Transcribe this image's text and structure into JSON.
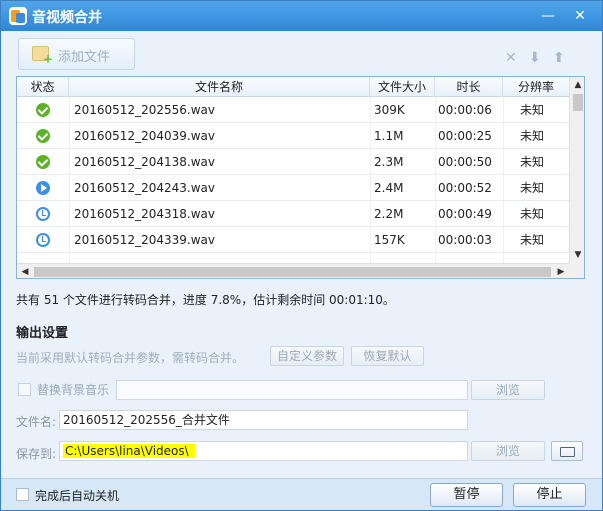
{
  "window": {
    "title": "音视频合并"
  },
  "titlebar": {
    "minimize_icon": "—",
    "close_icon": "✕"
  },
  "toolbar": {
    "add_files_label": "添加文件",
    "remove_icon": "✕",
    "move_down_icon": "⬇",
    "move_up_icon": "⬆"
  },
  "table": {
    "columns": [
      "状态",
      "文件名称",
      "文件大小",
      "时长",
      "分辨率"
    ],
    "rows": [
      {
        "status": "done",
        "name": "20160512_202556.wav",
        "size": "309K",
        "duration": "00:00:06",
        "resolution": "未知"
      },
      {
        "status": "done",
        "name": "20160512_204039.wav",
        "size": "1.1M",
        "duration": "00:00:25",
        "resolution": "未知"
      },
      {
        "status": "done",
        "name": "20160512_204138.wav",
        "size": "2.3M",
        "duration": "00:00:50",
        "resolution": "未知"
      },
      {
        "status": "processing",
        "name": "20160512_204243.wav",
        "size": "2.4M",
        "duration": "00:00:52",
        "resolution": "未知"
      },
      {
        "status": "waiting",
        "name": "20160512_204318.wav",
        "size": "2.2M",
        "duration": "00:00:49",
        "resolution": "未知"
      },
      {
        "status": "waiting",
        "name": "20160512_204339.wav",
        "size": "157K",
        "duration": "00:00:03",
        "resolution": "未知"
      }
    ]
  },
  "status": {
    "text": "共有 51 个文件进行转码合并，进度 7.8%，估计剩余时间 00:01:10。"
  },
  "output": {
    "section_title": "输出设置",
    "hint": "当前采用默认转码合并参数，需转码合并。",
    "custom_params_label": "自定义参数",
    "reset_label": "恢复默认",
    "replace_music_label": "替换背景音乐",
    "browse_label": "浏览",
    "filename_label": "文件名:",
    "filename_value": "20160512_202556_合并文件",
    "save_to_label": "保存到:",
    "save_to_value": "C:\\Users\\lina\\Videos\\"
  },
  "footer": {
    "auto_shutdown_label": "完成后自动关机",
    "pause_label": "暂停",
    "stop_label": "停止"
  }
}
